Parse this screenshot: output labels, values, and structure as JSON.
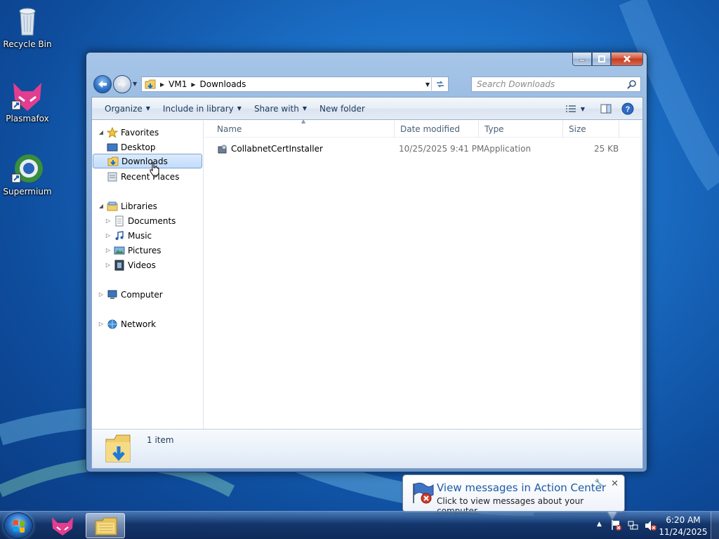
{
  "desktop": {
    "icons": [
      {
        "label": "Recycle Bin",
        "icon": "recycle-bin-icon"
      },
      {
        "label": "Plasmafox",
        "icon": "plasmafox-icon"
      },
      {
        "label": "Supermium",
        "icon": "supermium-icon"
      }
    ]
  },
  "window": {
    "controls": {
      "minimize": "minimize",
      "maximize": "maximize",
      "close": "close"
    },
    "address": {
      "root": "VM1",
      "current": "Downloads"
    },
    "search": {
      "placeholder": "Search Downloads"
    },
    "toolbar": {
      "organize": "Organize",
      "include_in_library": "Include in library",
      "share_with": "Share with",
      "new_folder": "New folder"
    },
    "nav": {
      "favorites": "Favorites",
      "desktop": "Desktop",
      "downloads": "Downloads",
      "recent_places": "Recent Places",
      "libraries": "Libraries",
      "documents": "Documents",
      "music": "Music",
      "pictures": "Pictures",
      "videos": "Videos",
      "computer": "Computer",
      "network": "Network"
    },
    "columns": {
      "name": "Name",
      "date_modified": "Date modified",
      "type": "Type",
      "size": "Size"
    },
    "files": [
      {
        "name": "CollabnetCertInstaller",
        "date_modified": "10/25/2025 9:41 PM",
        "type": "Application",
        "size": "25 KB"
      }
    ],
    "details": {
      "count": "1 item"
    }
  },
  "balloon": {
    "title": "View messages in Action Center",
    "body": "Click to view messages about your computer."
  },
  "taskbar": {
    "clock": {
      "time": "6:20 AM",
      "date": "11/24/2025"
    }
  },
  "colors": {
    "accent": "#1d5aa6",
    "selection": "#c1dcfc",
    "taskbar": "#16386e"
  }
}
